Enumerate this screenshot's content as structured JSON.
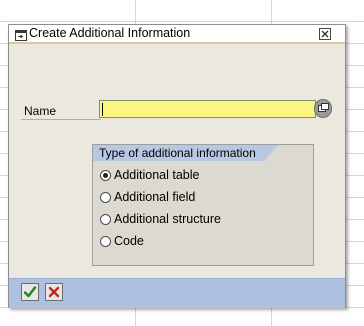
{
  "dialog": {
    "title": "Create Additional Information",
    "icons": {
      "title_icon": "dialog-window-icon",
      "close": "close-icon",
      "f4_help": "value-help-icon",
      "enter": "checkmark-icon",
      "cancel": "cancel-icon"
    }
  },
  "name_field": {
    "label": "Name",
    "value": "",
    "background_color": "#fbf582"
  },
  "group": {
    "title": "Type of additional information",
    "options": [
      {
        "label": "Additional table",
        "selected": true
      },
      {
        "label": "Additional field",
        "selected": false
      },
      {
        "label": "Additional structure",
        "selected": false
      },
      {
        "label": "Code",
        "selected": false
      }
    ]
  },
  "colors": {
    "dialog_bg": "#ebe8df",
    "group_tab_bg": "#b7c8e3",
    "footer_bg": "#adc0e0",
    "enter_green": "#2e7d1e",
    "cancel_red": "#c0281e"
  }
}
